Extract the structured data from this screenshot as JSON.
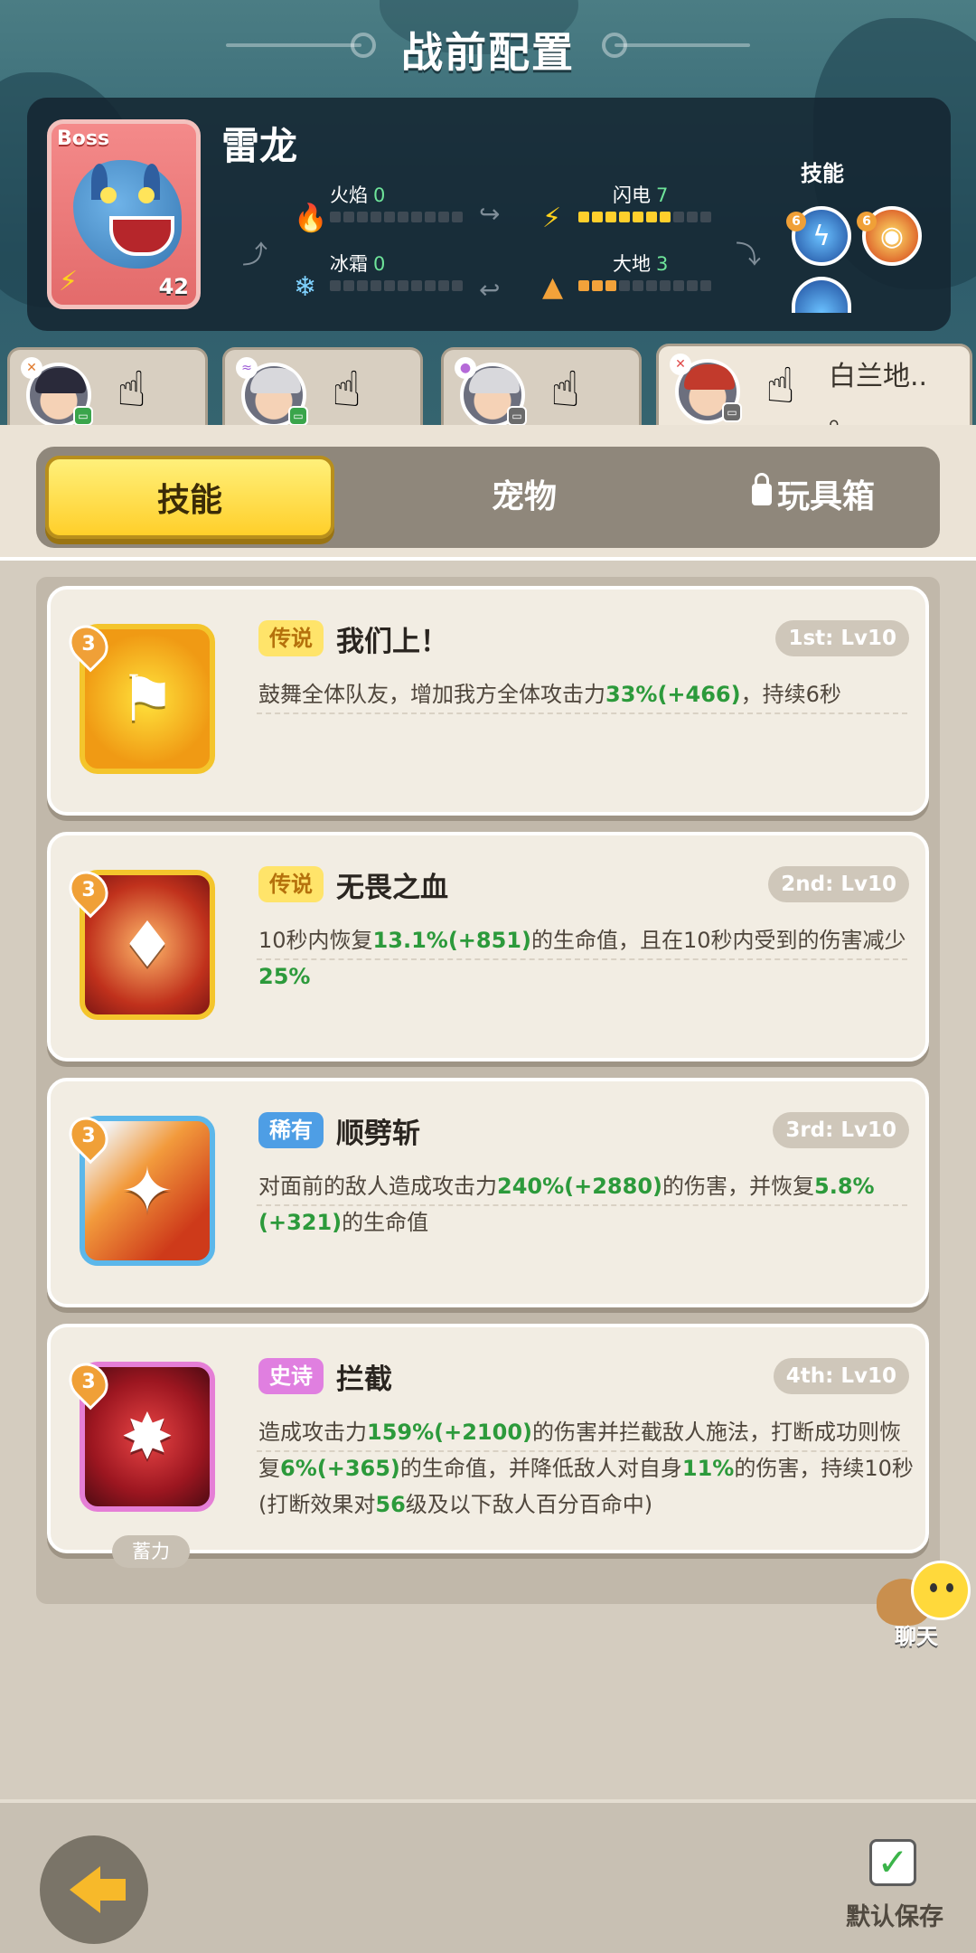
{
  "header": {
    "title": "战前配置"
  },
  "boss": {
    "tag": "Boss",
    "name": "雷龙",
    "level": "42",
    "elements": [
      {
        "name": "火焰",
        "value": "0",
        "icon": "fire-icon"
      },
      {
        "name": "闪电",
        "value": "7",
        "icon": "lightning-icon"
      },
      {
        "name": "冰霜",
        "value": "0",
        "icon": "snowflake-icon"
      },
      {
        "name": "大地",
        "value": "3",
        "icon": "earth-icon"
      }
    ],
    "skills_label": "技能",
    "skill_orbs": [
      "lightning-orb-icon",
      "fire-swirl-orb-icon",
      "lightning-orb-icon"
    ]
  },
  "heroes": [
    {
      "name": "",
      "badge": "green"
    },
    {
      "name": "",
      "badge": "green"
    },
    {
      "name": "",
      "badge": "gray"
    },
    {
      "name": "白兰地..",
      "badge": "gray",
      "active": true
    }
  ],
  "tabs": {
    "skills": "技能",
    "pets": "宠物",
    "toybox": "玩具箱"
  },
  "skills": [
    {
      "level": "3",
      "rarity": "传说",
      "name": "我们上！",
      "slot": "1st: Lv10",
      "desc_parts": [
        "鼓舞全体队友，增加我方全体攻击力",
        "33%",
        "(+466)",
        "，持续6秒"
      ],
      "icon": "charge-icon"
    },
    {
      "level": "3",
      "rarity": "传说",
      "name": "无畏之血",
      "slot": "2nd: Lv10",
      "desc_parts": [
        "10秒内恢复",
        "13.1%",
        "(+851)",
        "的生命值，且在10秒内受到的伤害减少",
        "25%"
      ],
      "icon": "blood-drop-icon"
    },
    {
      "level": "3",
      "rarity": "稀有",
      "name": "顺劈斩",
      "slot": "3rd: Lv10",
      "desc_parts": [
        "对面前的敌人造成攻击力",
        "240%",
        "(+2880)",
        "的伤害，并恢复",
        "5.8%",
        "(+321)",
        "的生命值"
      ],
      "icon": "cleave-icon"
    },
    {
      "level": "3",
      "rarity": "史诗",
      "name": "拦截",
      "slot": "4th: Lv10",
      "charge": "蓄力",
      "desc_parts": [
        "造成攻击力",
        "159%",
        "(+2100)",
        "的伤害并拦截敌人施法，打断成功则恢复",
        "6%",
        "(+365)",
        "的生命值，并降低敌人对自身",
        "11%",
        "的伤害，持续10秒(打断效果对",
        "56",
        "级及以下敌人百分百命中)"
      ],
      "icon": "intercept-icon"
    }
  ],
  "chat": {
    "label": "聊天"
  },
  "footer": {
    "save_label": "默认保存"
  }
}
